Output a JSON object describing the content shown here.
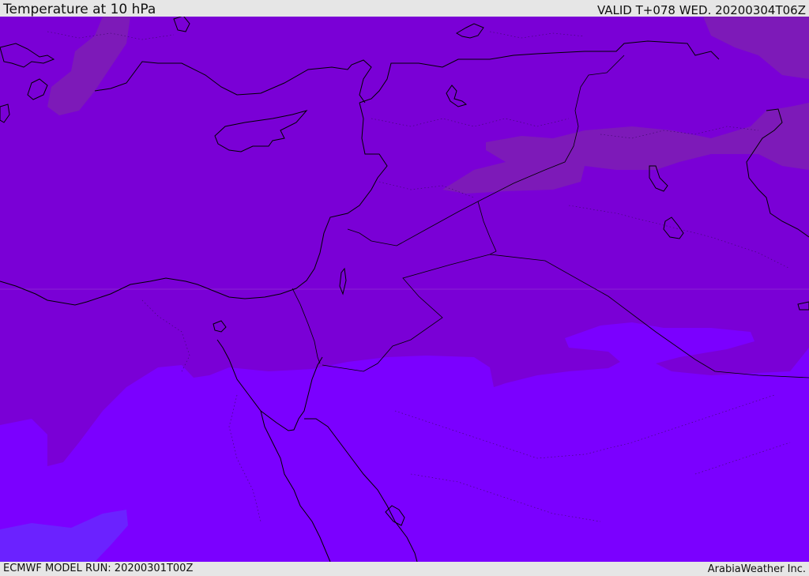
{
  "header": {
    "title": "Temperature at 10 hPa",
    "valid": "VALID T+078 WED. 20200304T06Z"
  },
  "footer": {
    "model_run": "ECMWF MODEL RUN: 20200301T00Z",
    "credit": "ArabiaWeather Inc."
  },
  "map": {
    "field": "temperature",
    "level": "10 hPa",
    "colors": {
      "base": "#7a00d6",
      "warm_band": "#7d1ab8",
      "cool_band": "#7b00ff",
      "coldest_patch": "#6b22ff",
      "coastline": "#000000"
    }
  }
}
